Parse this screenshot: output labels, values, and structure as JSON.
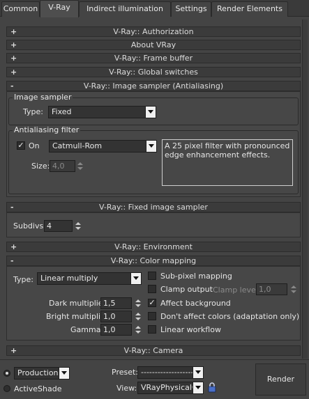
{
  "tabs": [
    {
      "label": "Common"
    },
    {
      "label": "V-Ray"
    },
    {
      "label": "Indirect illumination"
    },
    {
      "label": "Settings"
    },
    {
      "label": "Render Elements"
    }
  ],
  "rollouts": {
    "authorization": {
      "sign": "+",
      "title": "V-Ray:: Authorization"
    },
    "about": {
      "sign": "+",
      "title": "About VRay"
    },
    "frame_buffer": {
      "sign": "+",
      "title": "V-Ray:: Frame buffer"
    },
    "global_switches": {
      "sign": "+",
      "title": "V-Ray:: Global switches"
    },
    "image_sampler": {
      "sign": "-",
      "title": "V-Ray:: Image sampler (Antialiasing)"
    },
    "fixed_sampler": {
      "sign": "-",
      "title": "V-Ray:: Fixed image sampler"
    },
    "environment": {
      "sign": "+",
      "title": "V-Ray:: Environment"
    },
    "color_mapping": {
      "sign": "-",
      "title": "V-Ray:: Color mapping"
    },
    "camera": {
      "sign": "+",
      "title": "V-Ray:: Camera"
    }
  },
  "image_sampler": {
    "group_title": "Image sampler",
    "type_label": "Type:",
    "type_value": "Fixed"
  },
  "aa_filter": {
    "group_title": "Antialiasing filter",
    "on_label": "On",
    "on_checked": true,
    "filter_value": "Catmull-Rom",
    "size_label": "Size:",
    "size_value": "4,0",
    "description": "A 25 pixel filter with pronounced edge enhancement effects."
  },
  "fixed_sampler": {
    "subdivs_label": "Subdivs:",
    "subdivs_value": "4"
  },
  "color_mapping": {
    "type_label": "Type:",
    "type_value": "Linear multiply",
    "dark_label": "Dark multiplier:",
    "dark_value": "1,5",
    "bright_label": "Bright multiplier:",
    "bright_value": "1,0",
    "gamma_label": "Gamma:",
    "gamma_value": "1,0",
    "sub_pixel_label": "Sub-pixel mapping",
    "sub_pixel_checked": false,
    "clamp_output_label": "Clamp output",
    "clamp_output_checked": false,
    "clamp_level_label": "Clamp level:",
    "clamp_level_value": "1,0",
    "affect_background_label": "Affect background",
    "affect_background_checked": true,
    "dont_affect_label": "Don't affect colors (adaptation only)",
    "dont_affect_checked": false,
    "linear_workflow_label": "Linear workflow",
    "linear_workflow_checked": false
  },
  "bottom": {
    "production_label": "Production",
    "activeshade_label": "ActiveShade",
    "preset_label": "Preset:",
    "preset_value": "--------------------------",
    "view_label": "View:",
    "view_value": "VRayPhysicalC",
    "render_label": "Render"
  },
  "colors": {
    "background": "#444444",
    "rollout_header": "#3b3b3b",
    "field": "#333333"
  }
}
